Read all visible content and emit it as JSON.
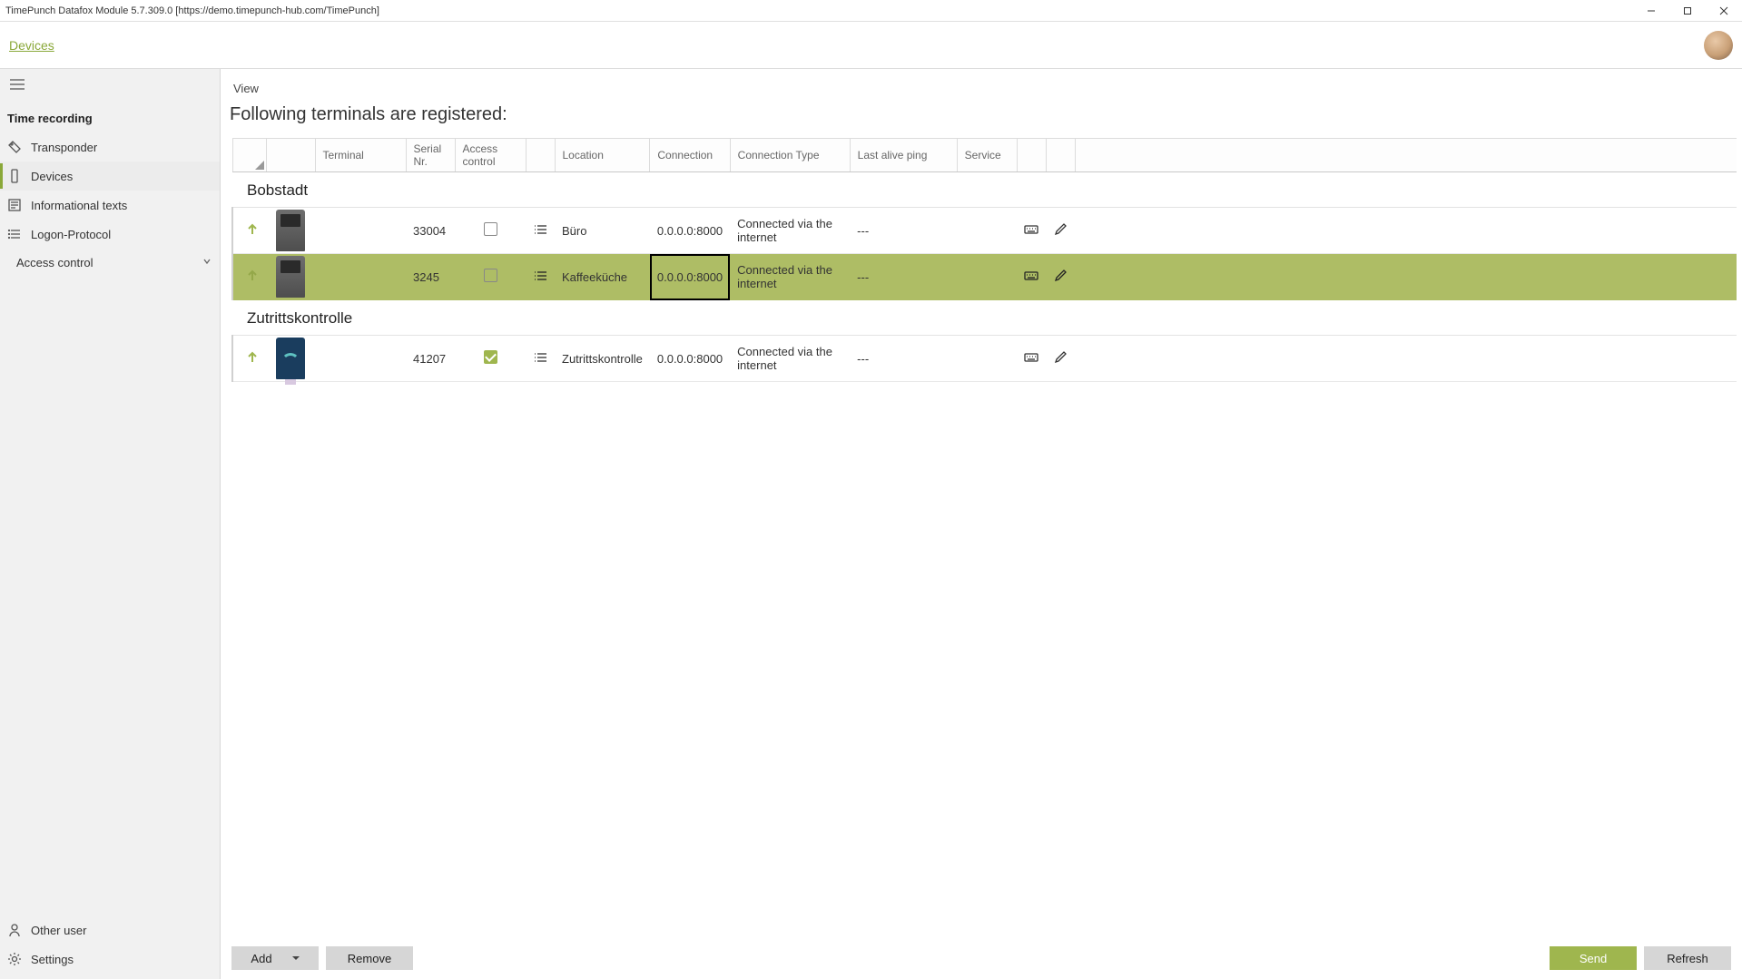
{
  "window": {
    "title": "TimePunch Datafox Module 5.7.309.0 [https://demo.timepunch-hub.com/TimePunch]"
  },
  "breadcrumb": {
    "devices": "Devices"
  },
  "sidebar": {
    "heading_time_recording": "Time recording",
    "items": [
      {
        "key": "transponder",
        "label": "Transponder"
      },
      {
        "key": "devices",
        "label": "Devices",
        "active": true
      },
      {
        "key": "info-texts",
        "label": "Informational texts"
      },
      {
        "key": "logon-protocol",
        "label": "Logon-Protocol"
      }
    ],
    "access_control": "Access control",
    "bottom": {
      "other_user": "Other user",
      "settings": "Settings"
    }
  },
  "main": {
    "tab_view": "View",
    "page_title": "Following terminals are registered:",
    "columns": {
      "terminal": "Terminal",
      "serial": "Serial Nr.",
      "access_control": "Access control",
      "location": "Location",
      "connection": "Connection",
      "connection_type": "Connection Type",
      "last_alive": "Last alive ping",
      "service": "Service"
    },
    "groups": [
      {
        "name": "Bobstadt",
        "rows": [
          {
            "serial": "33004",
            "access_control_checked": false,
            "location": "Büro",
            "connection": "0.0.0.0:8000",
            "connection_type": "Connected via the internet",
            "last_alive": "---",
            "service": "",
            "selected": false,
            "thumb": "terminal"
          },
          {
            "serial": "3245",
            "access_control_checked": false,
            "location": "Kaffeeküche",
            "connection": "0.0.0.0:8000",
            "connection_type": "Connected via the internet",
            "last_alive": "---",
            "service": "",
            "selected": true,
            "focus_column": "connection",
            "thumb": "terminal"
          }
        ]
      },
      {
        "name": "Zutrittskontrolle",
        "rows": [
          {
            "serial": "41207",
            "access_control_checked": true,
            "location": "Zutrittskontrolle",
            "connection": "0.0.0.0:8000",
            "connection_type": "Connected via the internet",
            "last_alive": "---",
            "service": "",
            "selected": false,
            "thumb": "wifi"
          }
        ]
      }
    ]
  },
  "footer": {
    "add": "Add",
    "remove": "Remove",
    "send": "Send",
    "refresh": "Refresh"
  }
}
